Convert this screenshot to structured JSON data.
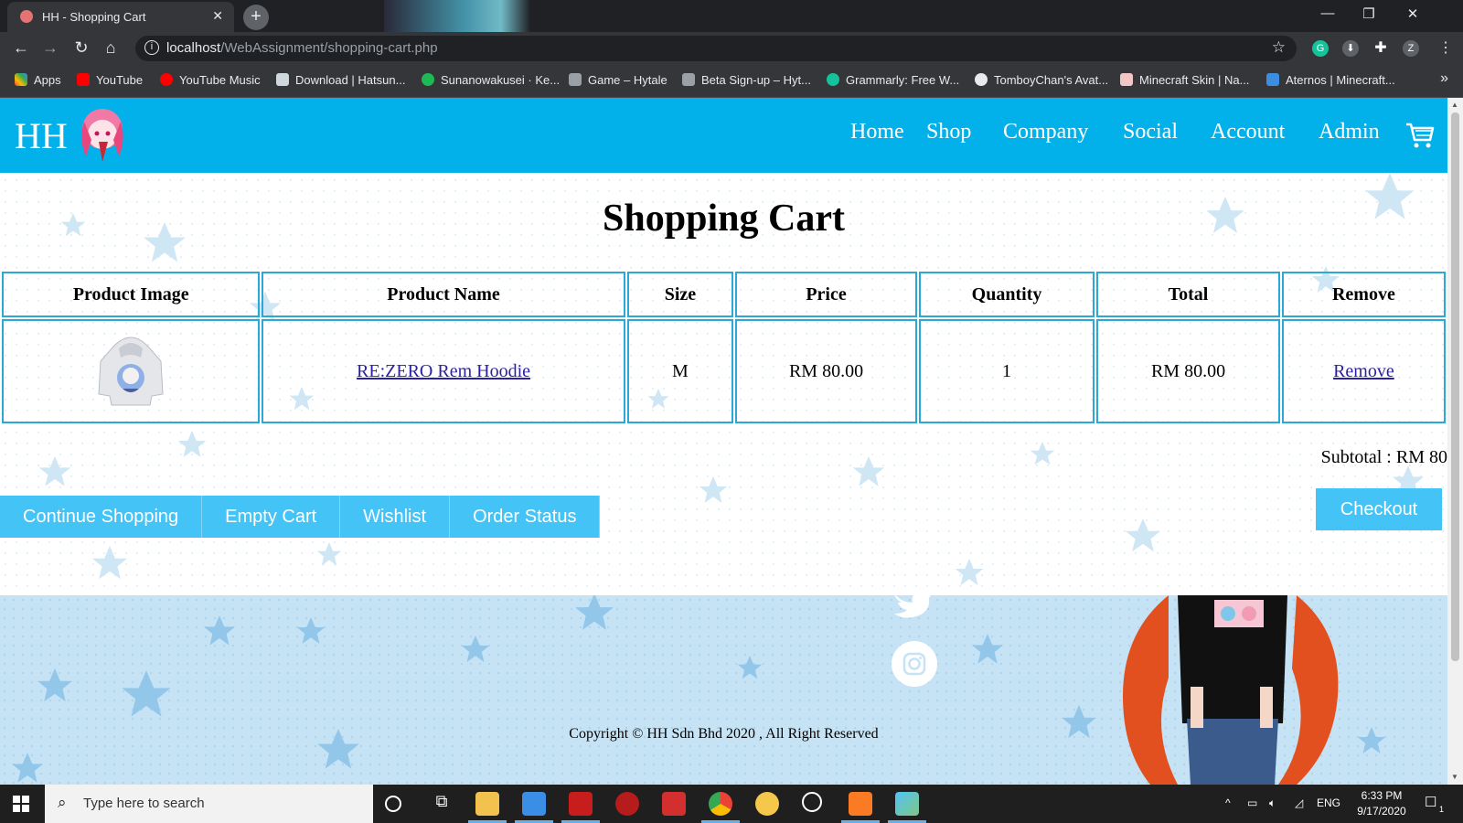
{
  "browser": {
    "tab_title": "HH - Shopping Cart",
    "tab_close": "✕",
    "new_tab": "+",
    "url_host": "localhost",
    "url_path": "/WebAssignment/shopping-cart.php",
    "profile_initial": "Z",
    "window_controls": [
      "—",
      "❐",
      "✕"
    ],
    "bookmarks": [
      {
        "label": "Apps",
        "color": "#e8453c"
      },
      {
        "label": "YouTube",
        "color": "#ff0000"
      },
      {
        "label": "YouTube Music",
        "color": "#ff0000"
      },
      {
        "label": "Download | Hatsun...",
        "color": "#cfd8dc"
      },
      {
        "label": "Sunanowakusei · Ke...",
        "color": "#1db954"
      },
      {
        "label": "Game – Hytale",
        "color": "#9aa0a6"
      },
      {
        "label": "Beta Sign-up – Hyt...",
        "color": "#9aa0a6"
      },
      {
        "label": "Grammarly: Free W...",
        "color": "#15c39a"
      },
      {
        "label": "TomboyChan's Avat...",
        "color": "#e8eaed"
      },
      {
        "label": "Minecraft Skin | Na...",
        "color": "#f3c6c6"
      },
      {
        "label": "Aternos | Minecraft...",
        "color": "#3c8fe0"
      }
    ],
    "bookmarks_more": "»"
  },
  "site": {
    "logo": "HH",
    "nav": [
      "Home",
      "Shop",
      "Company",
      "Social",
      "Account",
      "Admin"
    ],
    "title": "Shopping Cart",
    "table": {
      "headers": [
        "Product Image",
        "Product Name",
        "Size",
        "Price",
        "Quantity",
        "Total",
        "Remove"
      ],
      "rows": [
        {
          "name": "RE:ZERO Rem Hoodie",
          "size": "M",
          "price": "RM 80.00",
          "quantity": "1",
          "total": "RM 80.00",
          "remove": "Remove"
        }
      ]
    },
    "subtotal": "Subtotal : RM 80",
    "buttons": [
      "Continue Shopping",
      "Empty Cart",
      "Wishlist",
      "Order Status"
    ],
    "checkout": "Checkout",
    "copyright": "Copyright © HH Sdn Bhd 2020 , All Right Reserved",
    "colors": {
      "header": "#03b1ea",
      "button": "#43c3f6",
      "border": "#2ba9d6",
      "footer": "#c6e3f5"
    }
  },
  "taskbar": {
    "search_placeholder": "Type here to search",
    "language": "ENG",
    "time": "6:33 PM",
    "date": "9/17/2020",
    "notification_count": "1"
  }
}
